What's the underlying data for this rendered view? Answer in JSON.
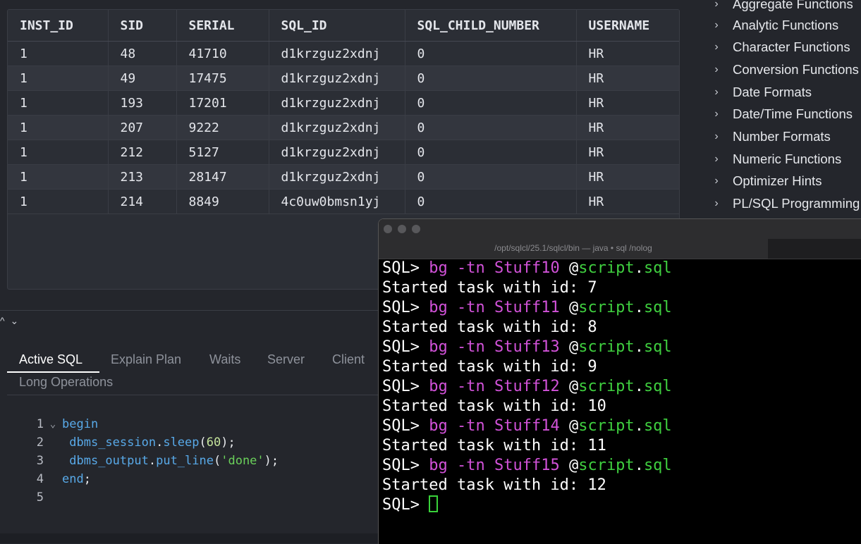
{
  "grid": {
    "columns": [
      "INST_ID",
      "SID",
      "SERIAL",
      "SQL_ID",
      "SQL_CHILD_NUMBER",
      "USERNAME"
    ],
    "rows": [
      [
        "1",
        "48",
        "41710",
        "d1krzguz2xdnj",
        "0",
        "HR"
      ],
      [
        "1",
        "49",
        "17475",
        "d1krzguz2xdnj",
        "0",
        "HR"
      ],
      [
        "1",
        "193",
        "17201",
        "d1krzguz2xdnj",
        "0",
        "HR"
      ],
      [
        "1",
        "207",
        "9222",
        "d1krzguz2xdnj",
        "0",
        "HR"
      ],
      [
        "1",
        "212",
        "5127",
        "d1krzguz2xdnj",
        "0",
        "HR"
      ],
      [
        "1",
        "213",
        "28147",
        "d1krzguz2xdnj",
        "0",
        "HR"
      ],
      [
        "1",
        "214",
        "8849",
        "4c0uw0bmsn1yj",
        "0",
        "HR"
      ]
    ]
  },
  "reference_tree": {
    "items": [
      "Aggregate Functions",
      "Analytic Functions",
      "Character Functions",
      "Conversion Functions",
      "Date Formats",
      "Date/Time Functions",
      "Number Formats",
      "Numeric Functions",
      "Optimizer Hints",
      "PL/SQL Programming"
    ]
  },
  "panel": {
    "collapse_glyphs": "^ ⌄",
    "tabs": [
      "Active SQL",
      "Explain Plan",
      "Waits",
      "Server",
      "Client",
      "Long Operations"
    ],
    "active_tab": "Active SQL"
  },
  "editor": {
    "line_numbers": [
      "1",
      "2",
      "3",
      "4",
      "5"
    ],
    "lines": {
      "l1": {
        "kw": "begin"
      },
      "l2": {
        "obj": "dbms_session",
        "dot": ".",
        "fn": "sleep",
        "open": "(",
        "num": "60",
        "close": ");"
      },
      "l3": {
        "obj": "dbms_output",
        "dot": ".",
        "fn": "put_line",
        "open": "(",
        "str": "'done'",
        "close": ");"
      },
      "l4": {
        "kw": "end",
        "semi": ";"
      }
    }
  },
  "terminal": {
    "title": "/opt/sqlcl/25.1/sqlcl/bin — java • sql /nolog",
    "prompt": "SQL>",
    "commands": [
      {
        "cmd": "bg",
        "flag": "-tn",
        "name": "Stuff10",
        "at": "@",
        "script": "script",
        "dot": ".",
        "ext": "sql",
        "result": "Started task with id: 7"
      },
      {
        "cmd": "bg",
        "flag": "-tn",
        "name": "Stuff11",
        "at": "@",
        "script": "script",
        "dot": ".",
        "ext": "sql",
        "result": "Started task with id: 8"
      },
      {
        "cmd": "bg",
        "flag": "-tn",
        "name": "Stuff13",
        "at": "@",
        "script": "script",
        "dot": ".",
        "ext": "sql",
        "result": "Started task with id: 9"
      },
      {
        "cmd": "bg",
        "flag": "-tn",
        "name": "Stuff12",
        "at": "@",
        "script": "script",
        "dot": ".",
        "ext": "sql",
        "result": "Started task with id: 10"
      },
      {
        "cmd": "bg",
        "flag": "-tn",
        "name": "Stuff14",
        "at": "@",
        "script": "script",
        "dot": ".",
        "ext": "sql",
        "result": "Started task with id: 11"
      },
      {
        "cmd": "bg",
        "flag": "-tn",
        "name": "Stuff15",
        "at": "@",
        "script": "script",
        "dot": ".",
        "ext": "sql",
        "result": "Started task with id: 12"
      }
    ]
  },
  "colors": {
    "background": "#24262c",
    "grid_bg": "#2b2e35",
    "keyword": "#58a9e8",
    "string": "#6ad05a",
    "number": "#c4e39b",
    "terminal_magenta": "#d252d9",
    "terminal_green": "#3fcf3f"
  }
}
